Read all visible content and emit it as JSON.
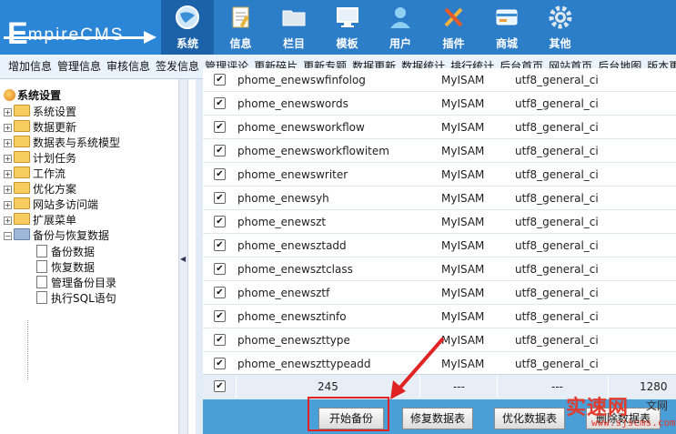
{
  "header": {
    "logo_letter": "E",
    "logo_rest": "mpireCMS",
    "nav": [
      {
        "label": "系统",
        "icon": "globe-icon"
      },
      {
        "label": "信息",
        "icon": "document-edit-icon"
      },
      {
        "label": "栏目",
        "icon": "folder-icon"
      },
      {
        "label": "模板",
        "icon": "monitor-icon"
      },
      {
        "label": "用户",
        "icon": "user-icon"
      },
      {
        "label": "插件",
        "icon": "tools-icon"
      },
      {
        "label": "商城",
        "icon": "credit-card-icon"
      },
      {
        "label": "其他",
        "icon": "gear-icon"
      }
    ],
    "active_index": 0
  },
  "menu": [
    "增加信息",
    "管理信息",
    "审核信息",
    "签发信息",
    "管理评论",
    "更新碎片",
    "更新专题",
    "数据更新",
    "数据统计",
    "排行统计",
    "后台首页",
    "网站首页",
    "后台地图",
    "版本更新"
  ],
  "sidebar": {
    "root": "系统设置",
    "items": [
      "系统设置",
      "数据更新",
      "数据表与系统模型",
      "计划任务",
      "工作流",
      "优化方案",
      "网站多访问端",
      "扩展菜单",
      "备份与恢复数据"
    ],
    "sub_items": [
      "备份数据",
      "恢复数据",
      "管理备份目录",
      "执行SQL语句"
    ]
  },
  "table": {
    "rows": [
      {
        "name": "phome_enewswfinfolog",
        "engine": "MyISAM",
        "collation": "utf8_general_ci"
      },
      {
        "name": "phome_enewswords",
        "engine": "MyISAM",
        "collation": "utf8_general_ci"
      },
      {
        "name": "phome_enewsworkflow",
        "engine": "MyISAM",
        "collation": "utf8_general_ci"
      },
      {
        "name": "phome_enewsworkflowitem",
        "engine": "MyISAM",
        "collation": "utf8_general_ci"
      },
      {
        "name": "phome_enewswriter",
        "engine": "MyISAM",
        "collation": "utf8_general_ci"
      },
      {
        "name": "phome_enewsyh",
        "engine": "MyISAM",
        "collation": "utf8_general_ci"
      },
      {
        "name": "phome_enewszt",
        "engine": "MyISAM",
        "collation": "utf8_general_ci"
      },
      {
        "name": "phome_enewsztadd",
        "engine": "MyISAM",
        "collation": "utf8_general_ci"
      },
      {
        "name": "phome_enewsztclass",
        "engine": "MyISAM",
        "collation": "utf8_general_ci"
      },
      {
        "name": "phome_enewsztf",
        "engine": "MyISAM",
        "collation": "utf8_general_ci"
      },
      {
        "name": "phome_enewsztinfo",
        "engine": "MyISAM",
        "collation": "utf8_general_ci"
      },
      {
        "name": "phome_enewszttype",
        "engine": "MyISAM",
        "collation": "utf8_general_ci"
      },
      {
        "name": "phome_enewszttypeadd",
        "engine": "MyISAM",
        "collation": "utf8_general_ci"
      }
    ],
    "summary": {
      "count": "245",
      "engine": "---",
      "collation": "---",
      "size": "1280"
    },
    "checkmark": "✔"
  },
  "buttons": {
    "start_backup": "开始备份",
    "repair": "修复数据表",
    "optimize": "优化数据表",
    "delete": "删除数据表"
  },
  "watermark": {
    "brand": "实速网",
    "suffix": "文网",
    "url": "www.sjscms.com"
  }
}
